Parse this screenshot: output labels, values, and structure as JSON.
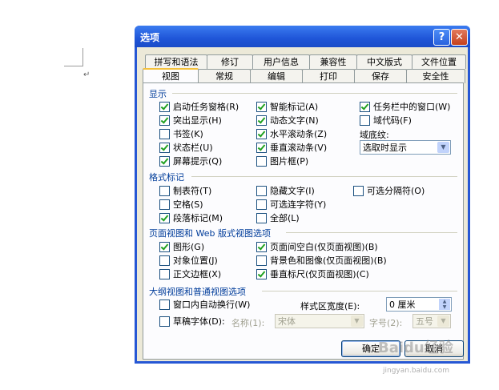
{
  "document": {
    "return_mark": "↵"
  },
  "dialog": {
    "title": "选项",
    "help_label": "?",
    "close_label": "✕",
    "tabs_row1": [
      "拼写和语法",
      "修订",
      "用户信息",
      "兼容性",
      "中文版式",
      "文件位置"
    ],
    "tabs_row2": [
      "视图",
      "常规",
      "编辑",
      "打印",
      "保存",
      "安全性"
    ],
    "active_tab": "视图",
    "show": {
      "header": "显示",
      "col1": [
        {
          "label": "启动任务窗格(R)",
          "checked": true
        },
        {
          "label": "突出显示(H)",
          "checked": true
        },
        {
          "label": "书签(K)",
          "checked": false
        },
        {
          "label": "状态栏(U)",
          "checked": true
        },
        {
          "label": "屏幕提示(Q)",
          "checked": true
        }
      ],
      "col2": [
        {
          "label": "智能标记(A)",
          "checked": true
        },
        {
          "label": "动态文字(N)",
          "checked": true
        },
        {
          "label": "水平滚动条(Z)",
          "checked": true
        },
        {
          "label": "垂直滚动条(V)",
          "checked": true
        },
        {
          "label": "图片框(P)",
          "checked": false
        }
      ],
      "col3": [
        {
          "label": "任务栏中的窗口(W)",
          "checked": true
        },
        {
          "label": "域代码(F)",
          "checked": false
        }
      ],
      "field_shading_label": "域底纹:",
      "field_shading_value": "选取时显示"
    },
    "format_marks": {
      "header": "格式标记",
      "col1": [
        {
          "label": "制表符(T)",
          "checked": false
        },
        {
          "label": "空格(S)",
          "checked": false
        },
        {
          "label": "段落标记(M)",
          "checked": true
        }
      ],
      "col2": [
        {
          "label": "隐藏文字(I)",
          "checked": false
        },
        {
          "label": "可选连字符(Y)",
          "checked": false
        },
        {
          "label": "全部(L)",
          "checked": false
        }
      ],
      "col3": [
        {
          "label": "可选分隔符(O)",
          "checked": false
        }
      ]
    },
    "page_web": {
      "header": "页面视图和 Web 版式视图选项",
      "col1": [
        {
          "label": "图形(G)",
          "checked": true
        },
        {
          "label": "对象位置(J)",
          "checked": false
        },
        {
          "label": "正文边框(X)",
          "checked": false
        }
      ],
      "col2": [
        {
          "label": "页面间空白(仅页面视图)(B)",
          "checked": true
        },
        {
          "label": "背景色和图像(仅页面视图)(B)",
          "checked": false
        },
        {
          "label": "垂直标尺(仅页面视图)(C)",
          "checked": true
        }
      ]
    },
    "outline_normal": {
      "header": "大纲视图和普通视图选项",
      "wrap_label": "窗口内自动换行(W)",
      "wrap_checked": false,
      "style_width_label": "样式区宽度(E):",
      "style_width_value": "0 厘米",
      "draft_label": "草稿字体(D):",
      "draft_checked": false,
      "font_name_label": "名称(1):",
      "font_name_value": "宋体",
      "font_size_label": "字号(2):",
      "font_size_value": "五号"
    },
    "ok_label": "确定",
    "cancel_label": "取消"
  },
  "watermark": {
    "text": "Baidu经验",
    "sub": "jingyan.baidu.com"
  }
}
